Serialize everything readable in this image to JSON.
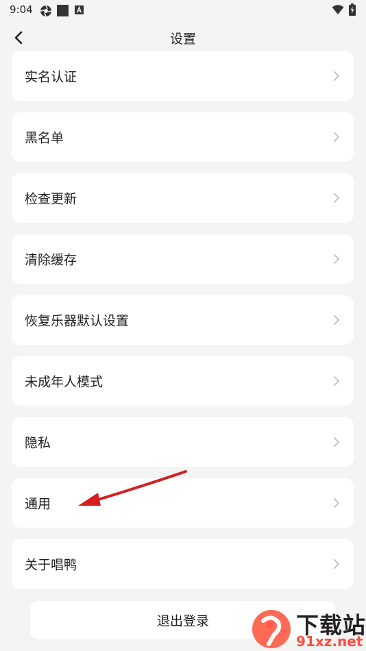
{
  "status_bar": {
    "time": "9:04"
  },
  "header": {
    "title": "设置"
  },
  "menu_items": [
    {
      "label": "实名认证"
    },
    {
      "label": "黑名单"
    },
    {
      "label": "检查更新"
    },
    {
      "label": "清除缓存"
    },
    {
      "label": "恢复乐器默认设置"
    },
    {
      "label": "未成年人模式"
    },
    {
      "label": "隐私"
    },
    {
      "label": "通用"
    },
    {
      "label": "关于唱鸭"
    }
  ],
  "logout": {
    "label": "退出登录"
  },
  "watermark": {
    "top_text": "下载站",
    "bottom_text": "91xz.net"
  },
  "colors": {
    "background": "#f4f4f4",
    "card": "#ffffff",
    "annotation_arrow": "#d42020",
    "watermark_red": "#ff4d3a"
  }
}
